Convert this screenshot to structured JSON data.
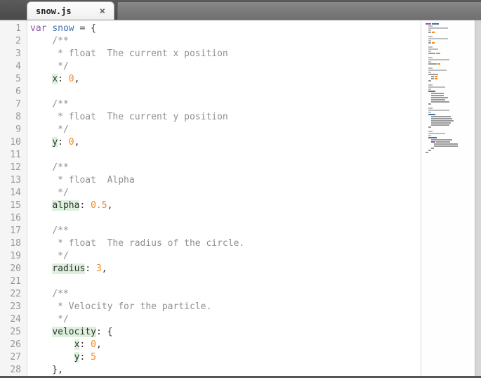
{
  "tab": {
    "filename": "snow.js",
    "close": "×"
  },
  "editor": {
    "line_count": 28,
    "code": {
      "l1": {
        "kw": "var",
        "sp1": " ",
        "name": "snow",
        "sp2": " ",
        "eq": "=",
        "sp3": " ",
        "brace": "{"
      },
      "l2": "    /**",
      "l3": "     * float  The current x position",
      "l4": "     */",
      "l5": {
        "indent": "    ",
        "prop": "x",
        "colon": ": ",
        "num": "0",
        "comma": ","
      },
      "l6": "",
      "l7": "    /**",
      "l8": "     * float  The current y position",
      "l9": "     */",
      "l10": {
        "indent": "    ",
        "prop": "y",
        "colon": ": ",
        "num": "0",
        "comma": ","
      },
      "l11": "",
      "l12": "    /**",
      "l13": "     * float  Alpha",
      "l14": "     */",
      "l15": {
        "indent": "    ",
        "prop": "alpha",
        "colon": ": ",
        "num": "0.5",
        "comma": ","
      },
      "l16": "",
      "l17": "    /**",
      "l18": "     * float  The radius of the circle.",
      "l19": "     */",
      "l20": {
        "indent": "    ",
        "prop": "radius",
        "colon": ": ",
        "num": "3",
        "comma": ","
      },
      "l21": "",
      "l22": "    /**",
      "l23": "     * Velocity for the particle.",
      "l24": "     */",
      "l25": {
        "indent": "    ",
        "prop": "velocity",
        "colon": ": ",
        "brace": "{"
      },
      "l26": {
        "indent": "        ",
        "prop": "x",
        "colon": ": ",
        "num": "0",
        "comma": ","
      },
      "l27": {
        "indent": "        ",
        "prop": "y",
        "colon": ": ",
        "num": "5"
      },
      "l28": "    },"
    }
  }
}
